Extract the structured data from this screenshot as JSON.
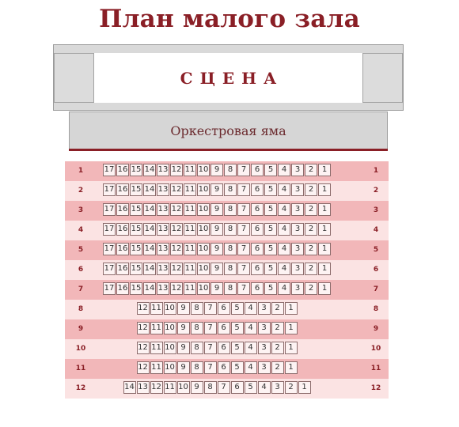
{
  "title": "План малого зала",
  "stage": {
    "label": "СЦЕНА"
  },
  "pit": {
    "label": "Оркестровая яма"
  },
  "colors": {
    "accent": "#8a1f26",
    "row_odd": "#f2b7b9",
    "row_even": "#fbe3e3"
  },
  "rows": [
    {
      "number": "1",
      "seats": [
        "17",
        "16",
        "15",
        "14",
        "13",
        "12",
        "11",
        "10",
        "9",
        "8",
        "7",
        "6",
        "5",
        "4",
        "3",
        "2",
        "1"
      ]
    },
    {
      "number": "2",
      "seats": [
        "17",
        "16",
        "15",
        "14",
        "13",
        "12",
        "11",
        "10",
        "9",
        "8",
        "7",
        "6",
        "5",
        "4",
        "3",
        "2",
        "1"
      ]
    },
    {
      "number": "3",
      "seats": [
        "17",
        "16",
        "15",
        "14",
        "13",
        "12",
        "11",
        "10",
        "9",
        "8",
        "7",
        "6",
        "5",
        "4",
        "3",
        "2",
        "1"
      ]
    },
    {
      "number": "4",
      "seats": [
        "17",
        "16",
        "15",
        "14",
        "13",
        "12",
        "11",
        "10",
        "9",
        "8",
        "7",
        "6",
        "5",
        "4",
        "3",
        "2",
        "1"
      ]
    },
    {
      "number": "5",
      "seats": [
        "17",
        "16",
        "15",
        "14",
        "13",
        "12",
        "11",
        "10",
        "9",
        "8",
        "7",
        "6",
        "5",
        "4",
        "3",
        "2",
        "1"
      ]
    },
    {
      "number": "6",
      "seats": [
        "17",
        "16",
        "15",
        "14",
        "13",
        "12",
        "11",
        "10",
        "9",
        "8",
        "7",
        "6",
        "5",
        "4",
        "3",
        "2",
        "1"
      ]
    },
    {
      "number": "7",
      "seats": [
        "17",
        "16",
        "15",
        "14",
        "13",
        "12",
        "11",
        "10",
        "9",
        "8",
        "7",
        "6",
        "5",
        "4",
        "3",
        "2",
        "1"
      ]
    },
    {
      "number": "8",
      "seats": [
        "12",
        "11",
        "10",
        "9",
        "8",
        "7",
        "6",
        "5",
        "4",
        "3",
        "2",
        "1"
      ]
    },
    {
      "number": "9",
      "seats": [
        "12",
        "11",
        "10",
        "9",
        "8",
        "7",
        "6",
        "5",
        "4",
        "3",
        "2",
        "1"
      ]
    },
    {
      "number": "10",
      "seats": [
        "12",
        "11",
        "10",
        "9",
        "8",
        "7",
        "6",
        "5",
        "4",
        "3",
        "2",
        "1"
      ]
    },
    {
      "number": "11",
      "seats": [
        "12",
        "11",
        "10",
        "9",
        "8",
        "7",
        "6",
        "5",
        "4",
        "3",
        "2",
        "1"
      ]
    },
    {
      "number": "12",
      "seats": [
        "14",
        "13",
        "12",
        "11",
        "10",
        "9",
        "8",
        "7",
        "6",
        "5",
        "4",
        "3",
        "2",
        "1"
      ]
    }
  ]
}
